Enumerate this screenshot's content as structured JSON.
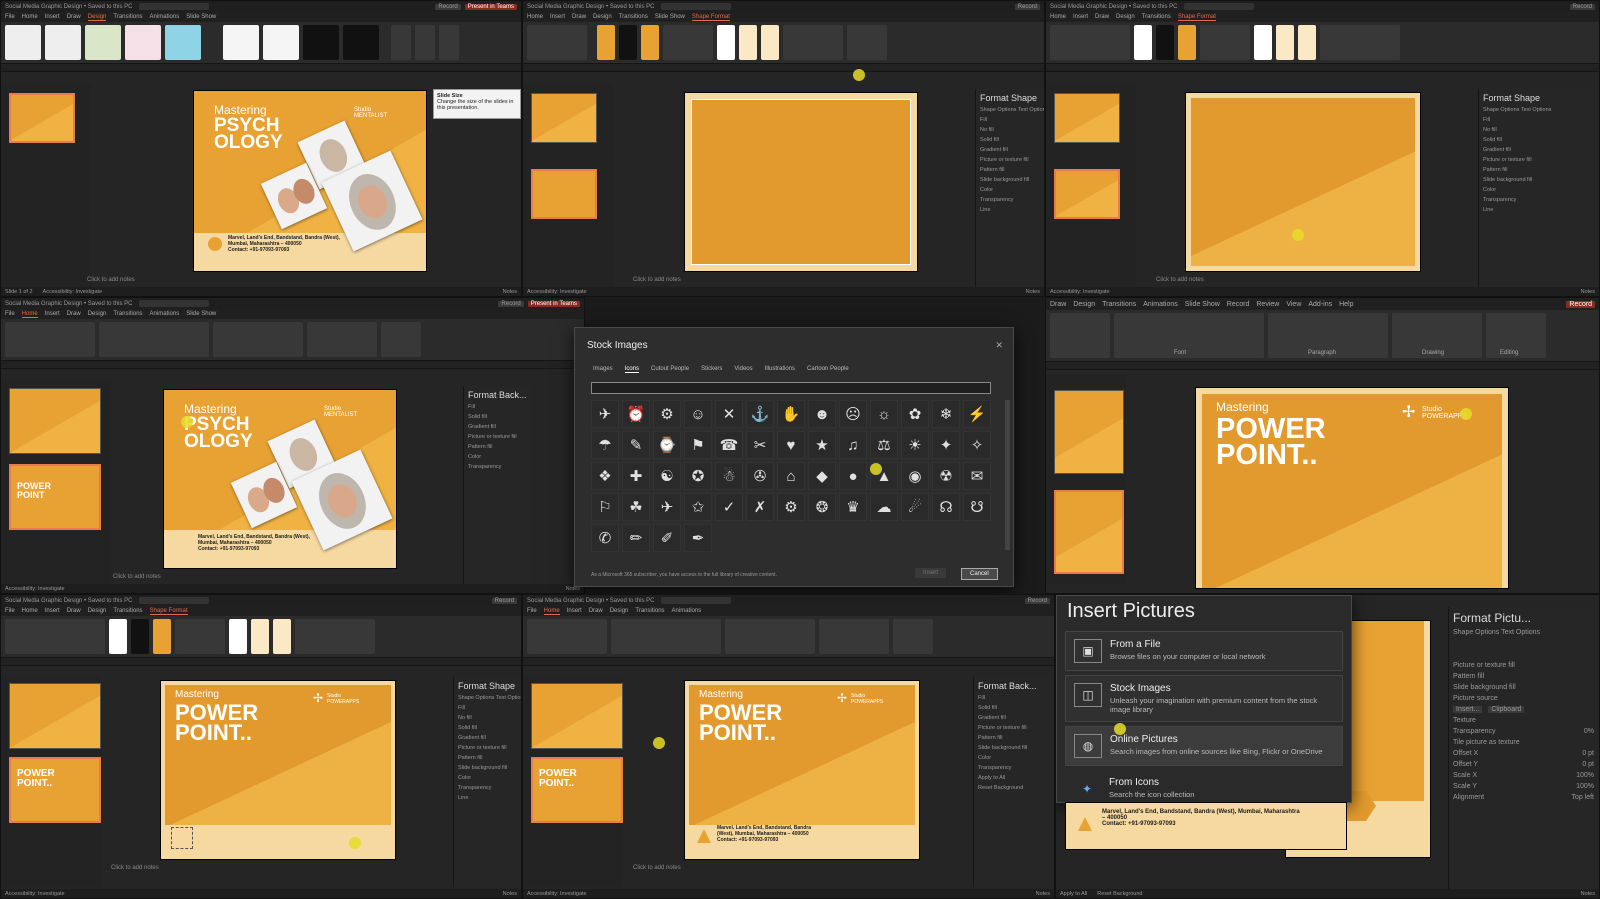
{
  "window": {
    "title": "Social Media Graphic Design • Saved to this PC",
    "search": "Search",
    "record": "Record",
    "present": "Present in Teams"
  },
  "tabs": [
    "File",
    "Home",
    "Insert",
    "Draw",
    "Design",
    "Transitions",
    "Animations",
    "Slide Show",
    "Record",
    "Review",
    "View",
    "Add-ins",
    "Help",
    "Shape Format"
  ],
  "ribbon_groups": [
    "Font",
    "Paragraph",
    "Drawing",
    "Editing"
  ],
  "slide1": {
    "kicker": "Mastering",
    "title": "PSYCH OLOGY",
    "brand": "Studio MENTALIST",
    "address": "Marvel, Land's End, Bandstand, Bandra (West), Mumbai, Maharashtra – 400050",
    "contact": "Contact: +91-97093-97093"
  },
  "slide2": {
    "kicker": "Mastering",
    "title_line1": "POWER",
    "title_line2": "POINT..",
    "brand": "Studio POWERAPPS",
    "address": "Marvel, Land's End, Bandstand, Bandra (West), Mumbai, Maharashtra – 400050",
    "contact": "Contact: +91-97093-97093"
  },
  "thumb2": {
    "line1": "POWER",
    "line2": "POINT"
  },
  "notes": "Click to add notes",
  "tooltip": {
    "title": "Slide Size",
    "body": "Change the size of the slides in this presentation."
  },
  "format_shape": {
    "title": "Format Shape",
    "tabs": "Shape Options   Text Options",
    "fill": "Fill",
    "options": [
      "No fill",
      "Solid fill",
      "Gradient fill",
      "Picture or texture fill",
      "Pattern fill",
      "Slide background fill"
    ],
    "color": "Color",
    "transparency": "Transparency",
    "line": "Line"
  },
  "format_background": {
    "title": "Format Back..."
  },
  "stock_images": {
    "title": "Stock Images",
    "tabs": [
      "Images",
      "Icons",
      "Cutout People",
      "Stickers",
      "Videos",
      "Illustrations",
      "Cartoon People"
    ],
    "footer_note": "As a Microsoft 365 subscriber, you have access to the full library of creative content.",
    "insert": "Insert",
    "cancel": "Cancel",
    "icons": [
      "✈",
      "⏰",
      "⚙",
      "☺",
      "✕",
      "⚓",
      "✋",
      "☻",
      "☹",
      "☼",
      "✿",
      "❄",
      "⚡",
      "☂",
      "✎",
      "⌚",
      "⚑",
      "☎",
      "✂",
      "♥",
      "★",
      "♫",
      "⚖",
      "☀",
      "✦",
      "✧",
      "❖",
      "✚",
      "☯",
      "✪",
      "☃",
      "✇",
      "⌂",
      "◆",
      "●",
      "▲",
      "◉",
      "☢",
      "✉",
      "⚐",
      "☘",
      "✈",
      "✩",
      "✓",
      "✗",
      "⚙",
      "❂",
      "♛",
      "☁",
      "☄",
      "☊",
      "☋",
      "✆",
      "✏",
      "✐",
      "✒"
    ]
  },
  "insert_pictures": {
    "title": "Insert Pictures",
    "items": [
      {
        "title": "From a File",
        "desc": "Browse files on your computer or local network"
      },
      {
        "title": "Stock Images",
        "desc": "Unleash your imagination with premium content from the stock image library"
      },
      {
        "title": "Online Pictures",
        "desc": "Search images from online sources like Bing, Flickr or OneDrive"
      },
      {
        "title": "From Icons",
        "desc": "Search the icon collection"
      }
    ]
  },
  "format_picture": {
    "title": "Format Pictu...",
    "tabs": "Shape Options   Text Options",
    "options": [
      "Picture or texture fill",
      "Pattern fill",
      "Slide background fill"
    ],
    "source": "Picture source",
    "insert": "Insert...",
    "clipboard": "Clipboard",
    "texture": "Texture",
    "transparency": "Transparency",
    "transparency_value": "0%",
    "tile": "Tile picture as texture",
    "offset_x": "Offset X",
    "offset_y": "Offset Y",
    "scale_x": "Scale X",
    "scale_y": "Scale Y",
    "alignment": "Alignment",
    "offset_x_value": "0 pt",
    "offset_y_value": "0 pt",
    "scale_x_value": "100%",
    "scale_y_value": "100%",
    "alignment_value": "Top left"
  },
  "status": {
    "slide": "Slide 1 of 2",
    "accessibility": "Accessibility: Investigate",
    "notes": "Notes",
    "apply_all": "Apply to All",
    "reset": "Reset Background"
  },
  "colors": {
    "accent": "#e87c4a",
    "orange": "#e8a233",
    "cream": "#f6d9a0"
  }
}
